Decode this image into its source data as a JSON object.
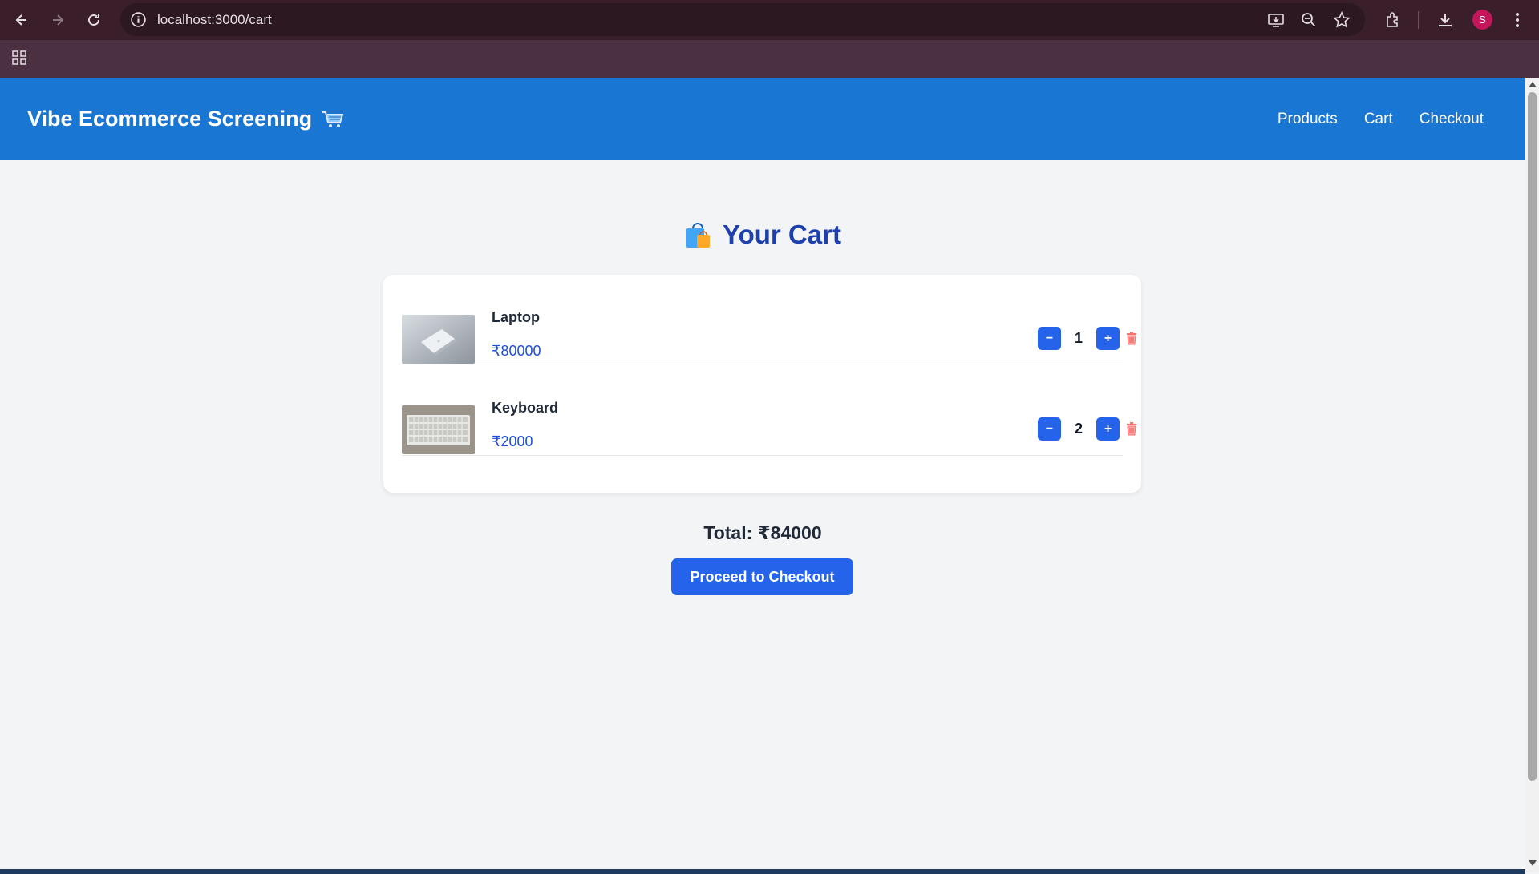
{
  "browser": {
    "url": "localhost:3000/cart",
    "profile_initial": "S",
    "colors": {
      "frame": "#3a1f2b",
      "omnibox": "#2b1820",
      "avatar": "#c2185b"
    }
  },
  "header": {
    "brand": "Vibe Ecommerce Screening",
    "brand_icon": "shopping-cart-icon",
    "nav": [
      "Products",
      "Cart",
      "Checkout"
    ],
    "colors": {
      "background": "#1976d2"
    }
  },
  "cart": {
    "title": "Your Cart",
    "title_icon": "shopping-bags-icon",
    "items": [
      {
        "name": "Laptop",
        "price": "₹80000",
        "quantity": "1",
        "image": "laptop-photo"
      },
      {
        "name": "Keyboard",
        "price": "₹2000",
        "quantity": "2",
        "image": "keyboard-photo"
      }
    ],
    "decrement_label": "−",
    "increment_label": "+",
    "total": "Total: ₹84000",
    "checkout_label": "Proceed to Checkout",
    "colors": {
      "accent": "#2563eb",
      "title": "#1e40af",
      "price": "#1d4ed8",
      "delete": "#f87171"
    }
  }
}
